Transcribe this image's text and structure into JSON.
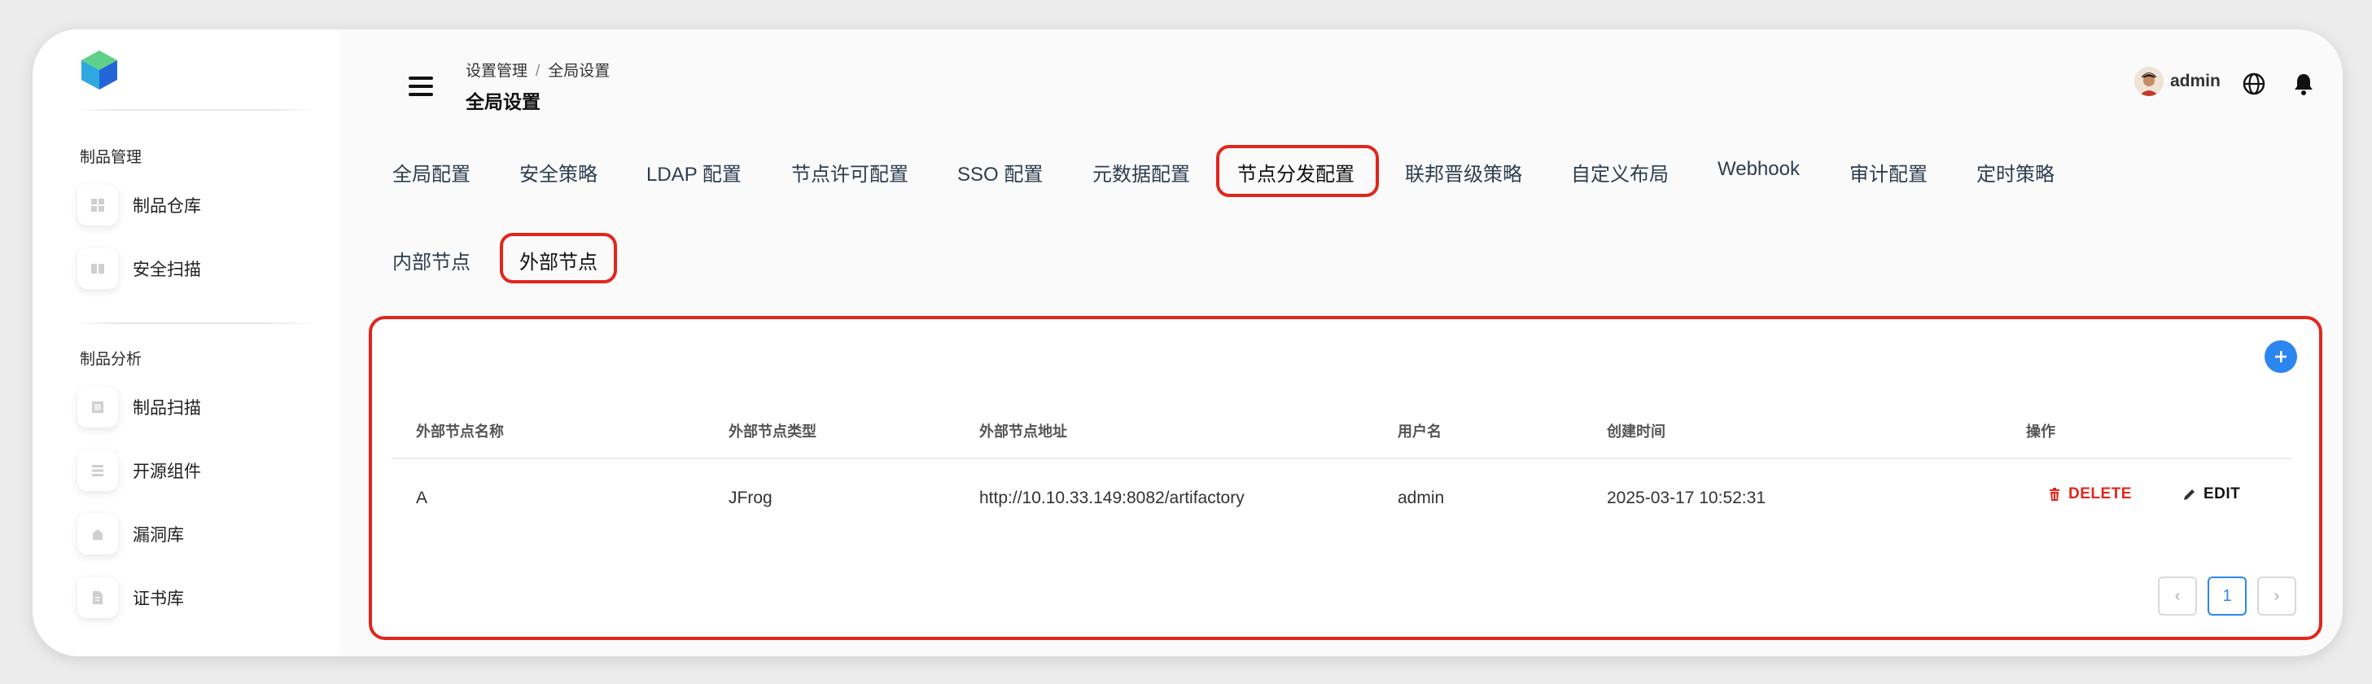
{
  "colors": {
    "accent": "#2b86f0",
    "highlight": "#e1261c",
    "delete": "#e1261c"
  },
  "sidebar": {
    "logo": "cube-logo",
    "groups": [
      {
        "label": "制品管理",
        "items": [
          {
            "label": "制品仓库",
            "icon": "grid-icon"
          },
          {
            "label": "安全扫描",
            "icon": "book-icon"
          }
        ]
      },
      {
        "label": "制品分析",
        "items": [
          {
            "label": "制品扫描",
            "icon": "scan-icon"
          },
          {
            "label": "开源组件",
            "icon": "list-icon"
          },
          {
            "label": "漏洞库",
            "icon": "bug-icon"
          },
          {
            "label": "证书库",
            "icon": "file-icon"
          }
        ]
      }
    ]
  },
  "header": {
    "breadcrumb": [
      "设置管理",
      "全局设置"
    ],
    "breadcrumb_separator": "/",
    "title": "全局设置",
    "username": "admin"
  },
  "tabs": {
    "main": [
      "全局配置",
      "安全策略",
      "LDAP 配置",
      "节点许可配置",
      "SSO 配置",
      "元数据配置",
      "节点分发配置",
      "联邦晋级策略",
      "自定义布局",
      "Webhook",
      "审计配置",
      "定时策略"
    ],
    "main_active": "节点分发配置",
    "sub": [
      "内部节点",
      "外部节点"
    ],
    "sub_active": "外部节点"
  },
  "table": {
    "columns": [
      "外部节点名称",
      "外部节点类型",
      "外部节点地址",
      "用户名",
      "创建时间",
      "操作"
    ],
    "rows": [
      {
        "name": "A",
        "type": "JFrog",
        "address": "http://10.10.33.149:8082/artifactory",
        "username": "admin",
        "created": "2025-03-17 10:52:31",
        "delete_label": "DELETE",
        "edit_label": "EDIT"
      }
    ]
  },
  "pagination": {
    "prev": "‹",
    "current": "1",
    "next": "›"
  }
}
